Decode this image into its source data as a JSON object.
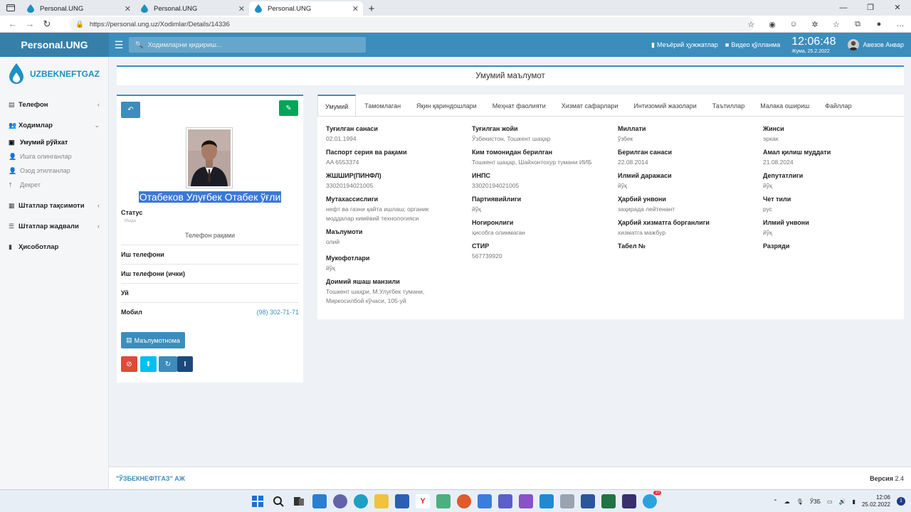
{
  "browser": {
    "tabs": [
      {
        "title": "Personal.UNG",
        "active": false
      },
      {
        "title": "Personal.UNG",
        "active": false
      },
      {
        "title": "Personal.UNG",
        "active": true
      }
    ],
    "url": "https://personal.ung.uz/Xodimlar/Details/14336"
  },
  "header": {
    "app_title": "Personal.UNG",
    "search_placeholder": "Ходимларни қидириш...",
    "docs_link": "Меъёрий ҳужжатлар",
    "video_link": "Видео қўлланма",
    "time": "12:06:48",
    "date": "Жума, 25.2.2022",
    "user_name": "Авезов Анвар"
  },
  "sidebar": {
    "brand": "UZBEKNEFTGAZ",
    "items": [
      {
        "label": "Телефон",
        "icon": "phone-icon"
      },
      {
        "label": "Ходимлар",
        "icon": "users-icon"
      },
      {
        "label": "Штатлар тақсимоти",
        "icon": "grid-icon"
      },
      {
        "label": "Штатлар жадвали",
        "icon": "list-icon"
      },
      {
        "label": "Ҳисоботлар",
        "icon": "file-icon"
      }
    ],
    "sub_items": [
      {
        "label": "Умумий рўйхат",
        "active": true
      },
      {
        "label": "Ишга олинганлар",
        "active": false
      },
      {
        "label": "Озод этилганлар",
        "active": false
      },
      {
        "label": "Декрет",
        "active": false
      }
    ]
  },
  "page": {
    "title": "Умумий маълумот"
  },
  "profile": {
    "name": "Отабеков Улуғбек Отабек ўғли",
    "status_label": "Статус",
    "status_value": "Ишда",
    "phone_header": "Телефон рақами",
    "phones": [
      {
        "label": "Иш телефони",
        "value": ""
      },
      {
        "label": "Иш телефони (ички)",
        "value": ""
      },
      {
        "label": "Уй",
        "value": ""
      },
      {
        "label": "Мобил",
        "value": "(98) 302-71-71"
      }
    ],
    "reference_button": "Маълумотнома"
  },
  "tabs": [
    "Умумий",
    "Тамомлаган",
    "Яқин қариндошлари",
    "Меҳнат фаолияти",
    "Хизмат сафарлари",
    "Интизомий жазолари",
    "Таътиллар",
    "Малака ошириш",
    "Файллар"
  ],
  "fields": {
    "col1": [
      {
        "label": "Туғилган санаси",
        "value": "02.01.1994"
      },
      {
        "label": "Паспорт серия ва рақами",
        "value": "AA 6553374"
      },
      {
        "label": "ЖШШИР(ПИНФЛ)",
        "value": "33020194021005"
      },
      {
        "label": "Мутахассислиги",
        "value": "нефт ва газни қайта ишлаш; органик моддалар кимёвий технологияси"
      },
      {
        "label": "Маълумоти",
        "value": "олий"
      },
      {
        "label": "Мукофотлари",
        "value": "йўқ"
      },
      {
        "label": "Доимий яшаш манзили",
        "value": "Тошкент шаҳри, М.Улуғбек тумани, Миркосилбой кўчаси, 105-уй"
      }
    ],
    "col2": [
      {
        "label": "Туғилган жойи",
        "value": "Ўзбекистон, Тошкент шаҳар"
      },
      {
        "label": "Ким томонидан берилган",
        "value": "Тошкент шаҳар, Шайхонтохур тумани ИИБ"
      },
      {
        "label": "ИНПС",
        "value": "33020194021005"
      },
      {
        "label": "Партиявийлиги",
        "value": "йўқ"
      },
      {
        "label": "Ногиронлиги",
        "value": "ҳисобга олинмаган"
      },
      {
        "label": "СТИР",
        "value": "567739920"
      }
    ],
    "col3": [
      {
        "label": "Миллати",
        "value": "ўзбек"
      },
      {
        "label": "Берилган санаси",
        "value": "22.08.2014"
      },
      {
        "label": "Илмий даражаси",
        "value": "йўқ"
      },
      {
        "label": "Ҳарбий унвони",
        "value": "заҳирада лейтенант"
      },
      {
        "label": "Ҳарбий хизматга борганлиги",
        "value": "хизматга мажбур"
      },
      {
        "label": "Табел №",
        "value": ""
      }
    ],
    "col4": [
      {
        "label": "Жинси",
        "value": "эркак"
      },
      {
        "label": "Амал қилиш муддати",
        "value": "21.08.2024"
      },
      {
        "label": "Депутатлиги",
        "value": "йўқ"
      },
      {
        "label": "Чет тили",
        "value": "рус"
      },
      {
        "label": "Илмий унвони",
        "value": "йўқ"
      },
      {
        "label": "Разряди",
        "value": ""
      }
    ]
  },
  "footer": {
    "company": "\"ЎЗБЕКНЕФТГАЗ\" АЖ",
    "version_label": "Версия",
    "version": "2.4"
  },
  "taskbar": {
    "lang": "ЎЗБ",
    "time": "12:06",
    "date": "25.02.2022",
    "notifications": "1",
    "badge": "10"
  },
  "colors": {
    "primary": "#3c8dbc",
    "header_dark": "#367fa9",
    "success": "#00a65a",
    "danger": "#dd4b39",
    "info": "#00c0ef"
  }
}
